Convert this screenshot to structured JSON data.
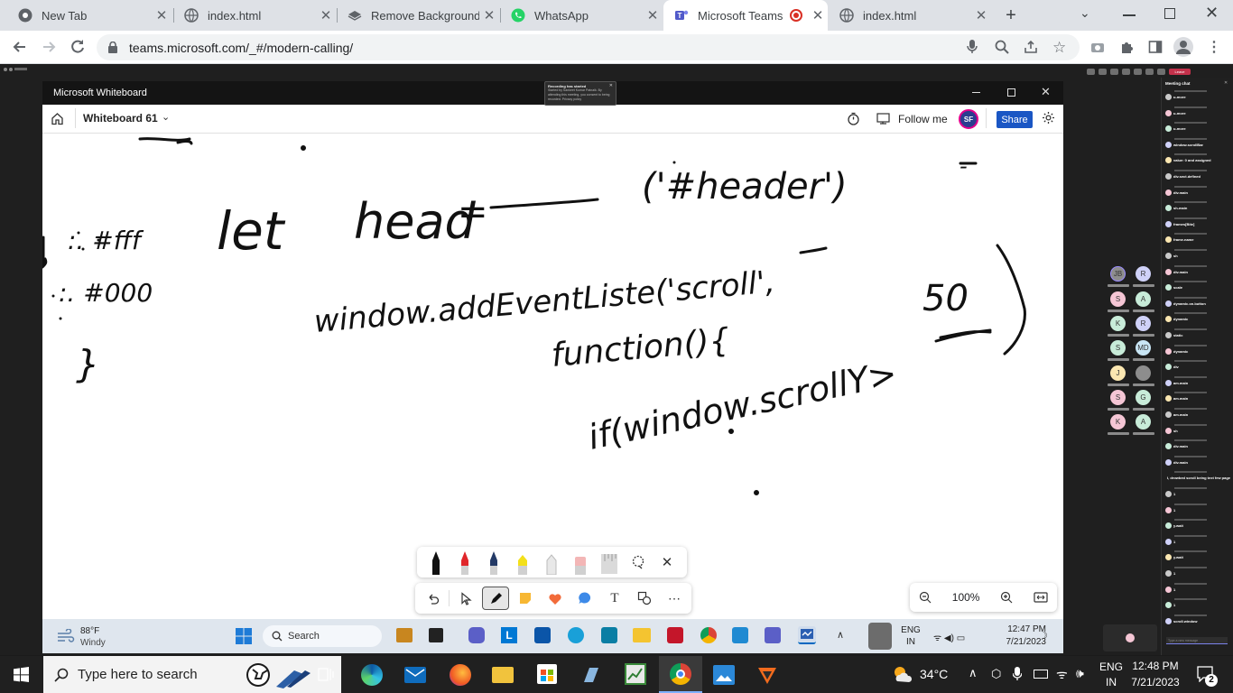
{
  "browser": {
    "tabs": [
      {
        "title": "New Tab",
        "icon": "chrome-icon",
        "active": false
      },
      {
        "title": "index.html",
        "icon": "globe-icon",
        "active": false
      },
      {
        "title": "Remove Background f",
        "icon": "removebg-icon",
        "active": false
      },
      {
        "title": "WhatsApp",
        "icon": "whatsapp-icon",
        "active": false
      },
      {
        "title": "Microsoft Teams",
        "icon": "teams-icon",
        "active": true
      },
      {
        "title": "index.html",
        "icon": "globe-icon",
        "active": false
      }
    ],
    "new_tab_label": "+",
    "url": "teams.microsoft.com/_#/modern-calling/"
  },
  "teams": {
    "meeting_chat_title": "Meeting chat",
    "leave_label": "Leave",
    "recording_banner": {
      "title": "Recording has started",
      "body": "Started by Sankeet Kumar Patnaik. By attending this meeting, you consent to being recorded. Privacy policy"
    },
    "chat_messages": [
      "u-more",
      "u-more",
      "u-more",
      "window.scrollBar",
      "value: 0 and assigned",
      "div.sect.defined",
      "div.main",
      "sh-main",
      "frames[Bite]",
      "frame.name",
      "sh",
      "div.main",
      "scale",
      "dynamic.on.button",
      "dynamic",
      "static",
      "dynamic",
      "div",
      "am.main",
      "am.main",
      "am.main",
      "sh",
      "div.main",
      "div.main",
      "I, drowbed scroll being text few page",
      "1",
      "1",
      "y.wait",
      "1",
      "y.wait",
      "1",
      "1",
      "1",
      "scroll.window"
    ],
    "chat_input_placeholder": "Type a new message",
    "participants": [
      "JB",
      "R",
      "S",
      "A",
      "K",
      "R",
      "S",
      "MD",
      "J",
      "S",
      "G",
      "K",
      "A"
    ]
  },
  "whiteboard": {
    "app_title": "Microsoft Whiteboard",
    "board_name": "Whiteboard 61",
    "follow_me_label": "Follow me",
    "user_initials": "SF",
    "share_label": "Share",
    "zoom_level": "100%",
    "inner_taskbar": {
      "temperature": "88°F",
      "weather": "Windy",
      "search_label": "Search",
      "lang_top": "ENG",
      "lang_bottom": "IN",
      "time": "12:47 PM",
      "date": "7/21/2023"
    },
    "pen_colors": [
      "#111111",
      "#e0262a",
      "#243a66",
      "#f3e01a",
      "#e8e8e8",
      "#f3b6b6",
      "#dadada"
    ],
    "handwriting": [
      ":. #fff",
      ":. #000",
      "}",
      "let",
      "head",
      "=",
      "('#header')",
      "window.addEventListe('scroll',",
      "function(){",
      "if(window.scrollY>",
      "50",
      "-"
    ]
  },
  "taskbar": {
    "search_placeholder": "Type here to search",
    "weather_temp": "34°C",
    "lang_top": "ENG",
    "lang_bottom": "IN",
    "time": "12:48 PM",
    "date": "7/21/2023",
    "notification_count": "2"
  }
}
